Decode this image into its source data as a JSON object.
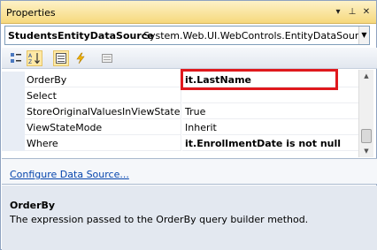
{
  "window": {
    "title": "Properties",
    "buttons": {
      "dropdown": "▾",
      "pin": "⊥",
      "close": "✕"
    }
  },
  "object_selector": {
    "name": "StudentsEntityDataSource",
    "type": "System.Web.UI.WebControls.EntityDataSource"
  },
  "toolbar": {
    "buttons": [
      {
        "name": "categorized-button",
        "icon": "categorized-icon",
        "active": false
      },
      {
        "name": "alphabetical-button",
        "icon": "alphabetical-icon",
        "active": true
      },
      {
        "name": "properties-button",
        "icon": "properties-icon",
        "active": true
      },
      {
        "name": "events-button",
        "icon": "lightning-icon",
        "active": false
      },
      {
        "name": "property-pages-button",
        "icon": "property-pages-icon",
        "active": false
      }
    ]
  },
  "properties": [
    {
      "name": "OrderBy",
      "value": "it.LastName",
      "bold": true,
      "selected": true
    },
    {
      "name": "Select",
      "value": "",
      "bold": false
    },
    {
      "name": "StoreOriginalValuesInViewState",
      "value": "True",
      "bold": false
    },
    {
      "name": "ViewStateMode",
      "value": "Inherit",
      "bold": false
    },
    {
      "name": "Where",
      "value": "it.EnrollmentDate is not null",
      "bold": true
    }
  ],
  "commands": {
    "link": "Configure Data Source..."
  },
  "description": {
    "title": "OrderBy",
    "text": "The expression passed to the OrderBy query builder method."
  },
  "colors": {
    "highlight": "#e0191d",
    "link": "#0645ad",
    "title_bar": "#f6d97c"
  }
}
